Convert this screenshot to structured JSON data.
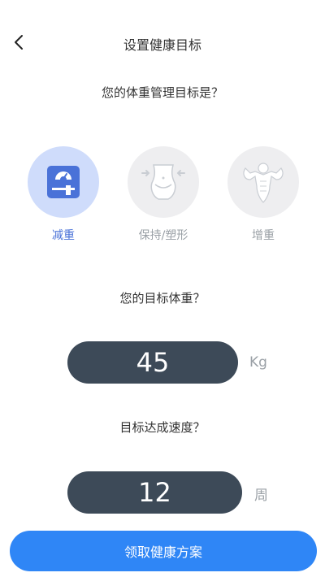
{
  "header": {
    "title": "设置健康目标",
    "back_icon": "chevron-left-icon"
  },
  "goal_section": {
    "question": "您的体重管理目标是？",
    "options": [
      {
        "label": "减重",
        "icon": "scale-icon",
        "selected": true
      },
      {
        "label": "保持/塑形",
        "icon": "waist-icon",
        "selected": false
      },
      {
        "label": "增重",
        "icon": "muscle-icon",
        "selected": false
      }
    ]
  },
  "target_weight": {
    "question": "您的目标体重？",
    "value": "45",
    "unit": "Kg"
  },
  "speed": {
    "question": "目标达成速度？",
    "value": "12",
    "unit": "周"
  },
  "cta_label": "领取健康方案",
  "colors": {
    "accent": "#2f86f6",
    "selected_bg": "#cfdcfb",
    "selected_icon": "#4a72d8",
    "pill_bg": "#3d4a58",
    "muted": "#9aa0a6"
  }
}
